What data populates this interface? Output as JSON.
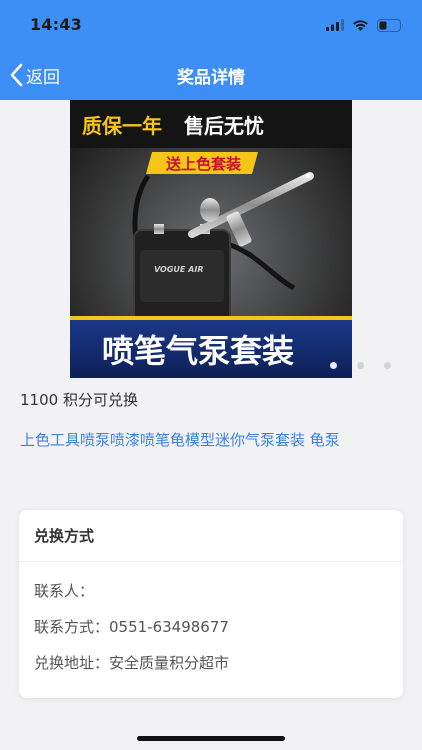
{
  "status": {
    "time": "14:43"
  },
  "nav": {
    "back_label": "返回",
    "title": "奖品详情"
  },
  "banner": {
    "top_text_left": "质保一年",
    "top_text_right": "售后无忧",
    "tag_text": "送上色套装",
    "brand_text": "VOGUE AIR",
    "bottom_text": "喷笔气泵套装"
  },
  "carousel": {
    "total": 3,
    "current": 1
  },
  "product": {
    "points_text": "1100 积分可兑换",
    "name": "上色工具喷泵喷漆喷笔龟模型迷你气泵套装 龟泵"
  },
  "exchange": {
    "title": "兑换方式",
    "contact_person": "联系人：",
    "contact_phone": "联系方式：0551-63498677",
    "address": "兑换地址：安全质量积分超市"
  },
  "colors": {
    "header": "#3d8ff5",
    "link": "#3b82e0",
    "background": "#f2f2f4"
  }
}
